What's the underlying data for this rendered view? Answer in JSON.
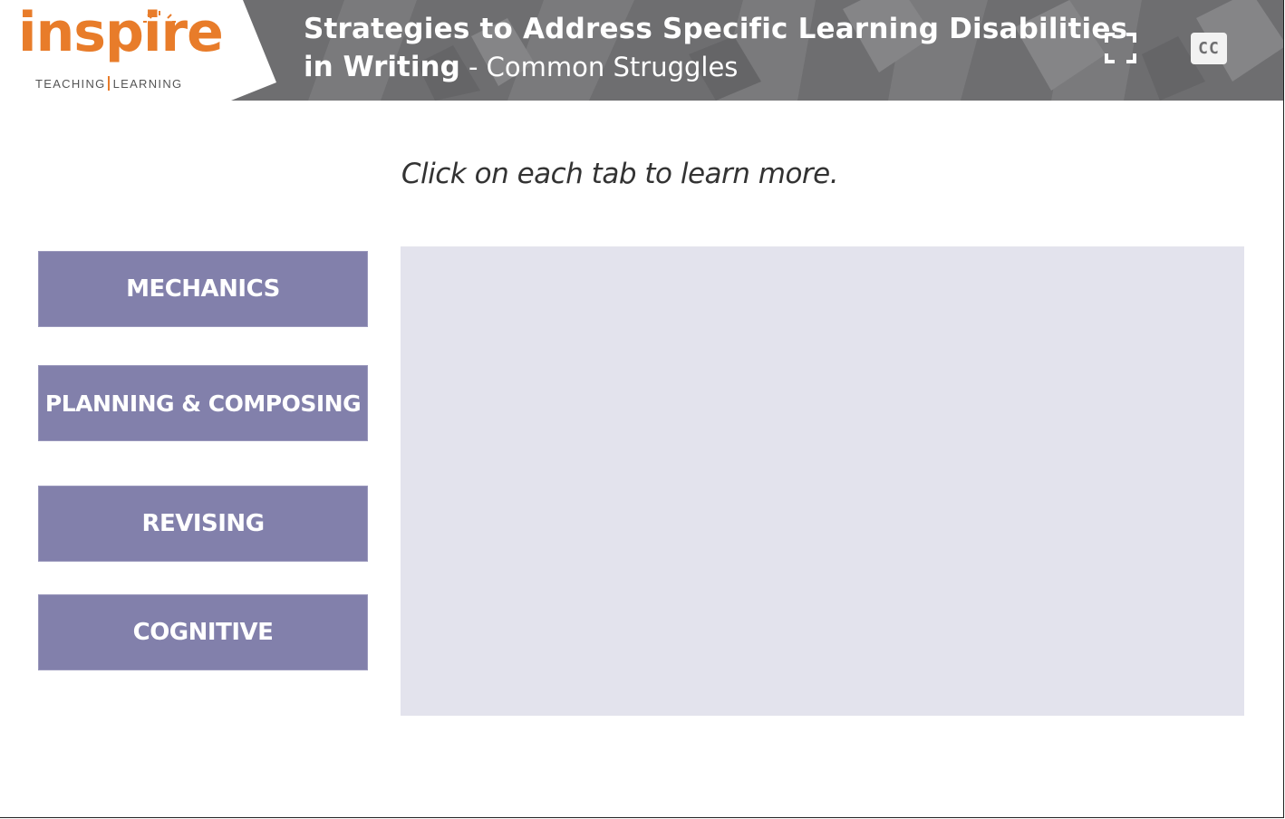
{
  "logo": {
    "brand": "inspire",
    "tagline_left": "TEACHING",
    "tagline_right": "LEARNING"
  },
  "header": {
    "title_line1": "Strategies to Address Specific Learning Disabilities",
    "title_line2_bold": "in Writing",
    "title_line2_sub": " - Common Struggles",
    "fullscreen_icon": "fullscreen-icon",
    "cc_label": "CC"
  },
  "main": {
    "instruction": "Click on each tab to learn more.",
    "tabs": [
      {
        "label": "MECHANICS"
      },
      {
        "label": "PLANNING & COMPOSING"
      },
      {
        "label": "REVISING"
      },
      {
        "label": "COGNITIVE"
      }
    ]
  },
  "colors": {
    "header_bg": "#6e6e70",
    "brand_orange": "#e87c2a",
    "tab_bg": "#8280ab",
    "panel_bg": "#e3e3ed"
  }
}
